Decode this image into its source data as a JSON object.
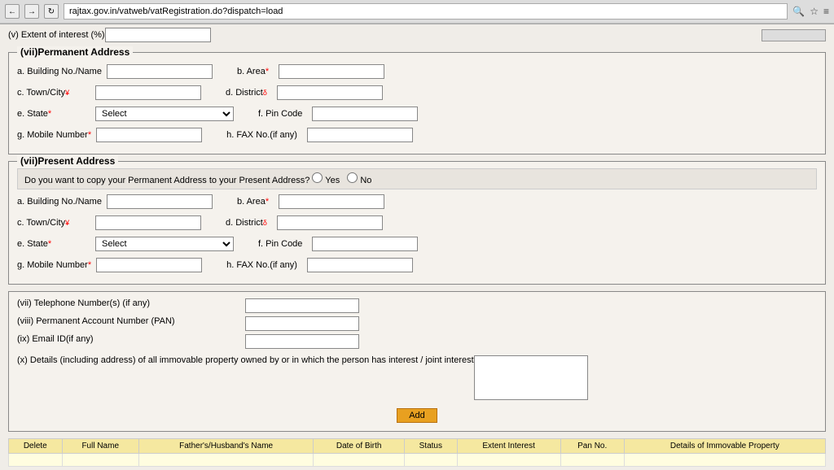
{
  "browser": {
    "url": "rajtax.gov.in/vatweb/vatRegistration.do?dispatch=load",
    "back_label": "←",
    "forward_label": "→",
    "reload_label": "↻",
    "icons": [
      "🔍",
      "☆",
      "≡"
    ]
  },
  "extent_section": {
    "label": "(v) Extent of interest (%)"
  },
  "permanent_address": {
    "title": "(vii)Permanent Address",
    "fields": {
      "building_label": "a. Building No./Name",
      "area_label": "b. Area",
      "town_label": "c. Town/City",
      "district_label": "d. District",
      "state_label": "e. State",
      "state_default": "Select",
      "pincode_label": "f. Pin Code",
      "mobile_label": "g. Mobile Number",
      "fax_label": "h. FAX No.(if any)"
    }
  },
  "present_address": {
    "title": "(vii)Present Address",
    "copy_question": "Do you want to copy your Permanent Address to your Present Address?",
    "yes_label": "Yes",
    "no_label": "No",
    "fields": {
      "building_label": "a. Building No./Name",
      "area_label": "b. Area",
      "town_label": "c. Town/City",
      "district_label": "d. District",
      "state_label": "e. State",
      "state_default": "Select",
      "pincode_label": "f. Pin Code",
      "mobile_label": "g. Mobile Number",
      "fax_label": "h. FAX No.(if any)"
    }
  },
  "other_info": {
    "telephone_label": "(vii) Telephone Number(s) (if any)",
    "pan_label": "(viii) Permanent Account Number (PAN)",
    "email_label": "(ix) Email ID(if any)",
    "property_label": "(x)  Details (including address) of all immovable property owned by or in which the person has interest / joint interest",
    "add_button": "Add"
  },
  "table": {
    "columns": [
      "Delete",
      "Full Name",
      "Father's/Husband's Name",
      "Date of Birth",
      "Status",
      "Extent Interest",
      "Pan No.",
      "Details of Immovable Property"
    ]
  }
}
